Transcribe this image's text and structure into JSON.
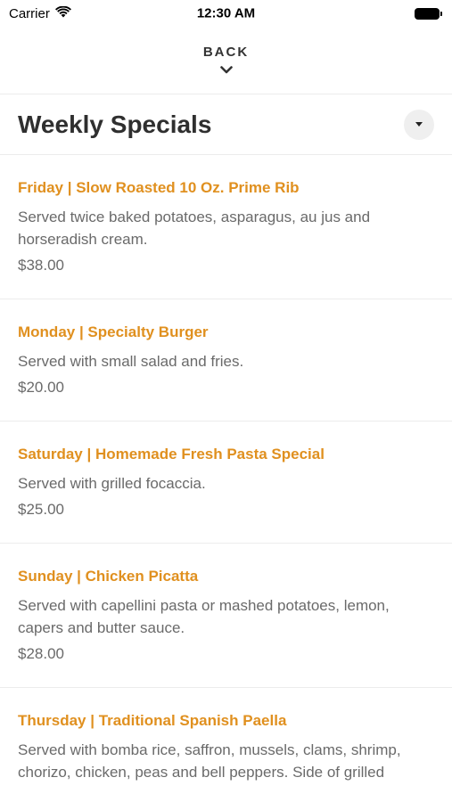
{
  "status_bar": {
    "carrier": "Carrier",
    "time": "12:30 AM",
    "wifi_icon": "wifi-icon",
    "battery_icon": "battery-icon"
  },
  "nav": {
    "back_label": "BACK",
    "back_icon": "chevron-down-icon"
  },
  "section": {
    "title": "Weekly Specials",
    "dropdown_icon": "caret-down-icon"
  },
  "items": [
    {
      "title": "Friday | Slow Roasted 10 Oz. Prime Rib",
      "description": "Served twice baked potatoes, asparagus, au jus and horseradish cream.",
      "price": "$38.00"
    },
    {
      "title": "Monday | Specialty Burger",
      "description": "Served with small salad and fries.",
      "price": "$20.00"
    },
    {
      "title": "Saturday | Homemade Fresh Pasta Special",
      "description": "Served with grilled focaccia.",
      "price": "$25.00"
    },
    {
      "title": "Sunday | Chicken Picatta",
      "description": "Served with capellini pasta or mashed potatoes, lemon, capers and butter sauce.",
      "price": "$28.00"
    },
    {
      "title": "Thursday | Traditional Spanish Paella",
      "description": "Served with bomba rice, saffron, mussels, clams, shrimp, chorizo, chicken, peas and bell peppers. Side of grilled",
      "price": ""
    }
  ],
  "colors": {
    "accent": "#e0901f",
    "text_muted": "#6a6a6a",
    "divider": "#ececec"
  }
}
